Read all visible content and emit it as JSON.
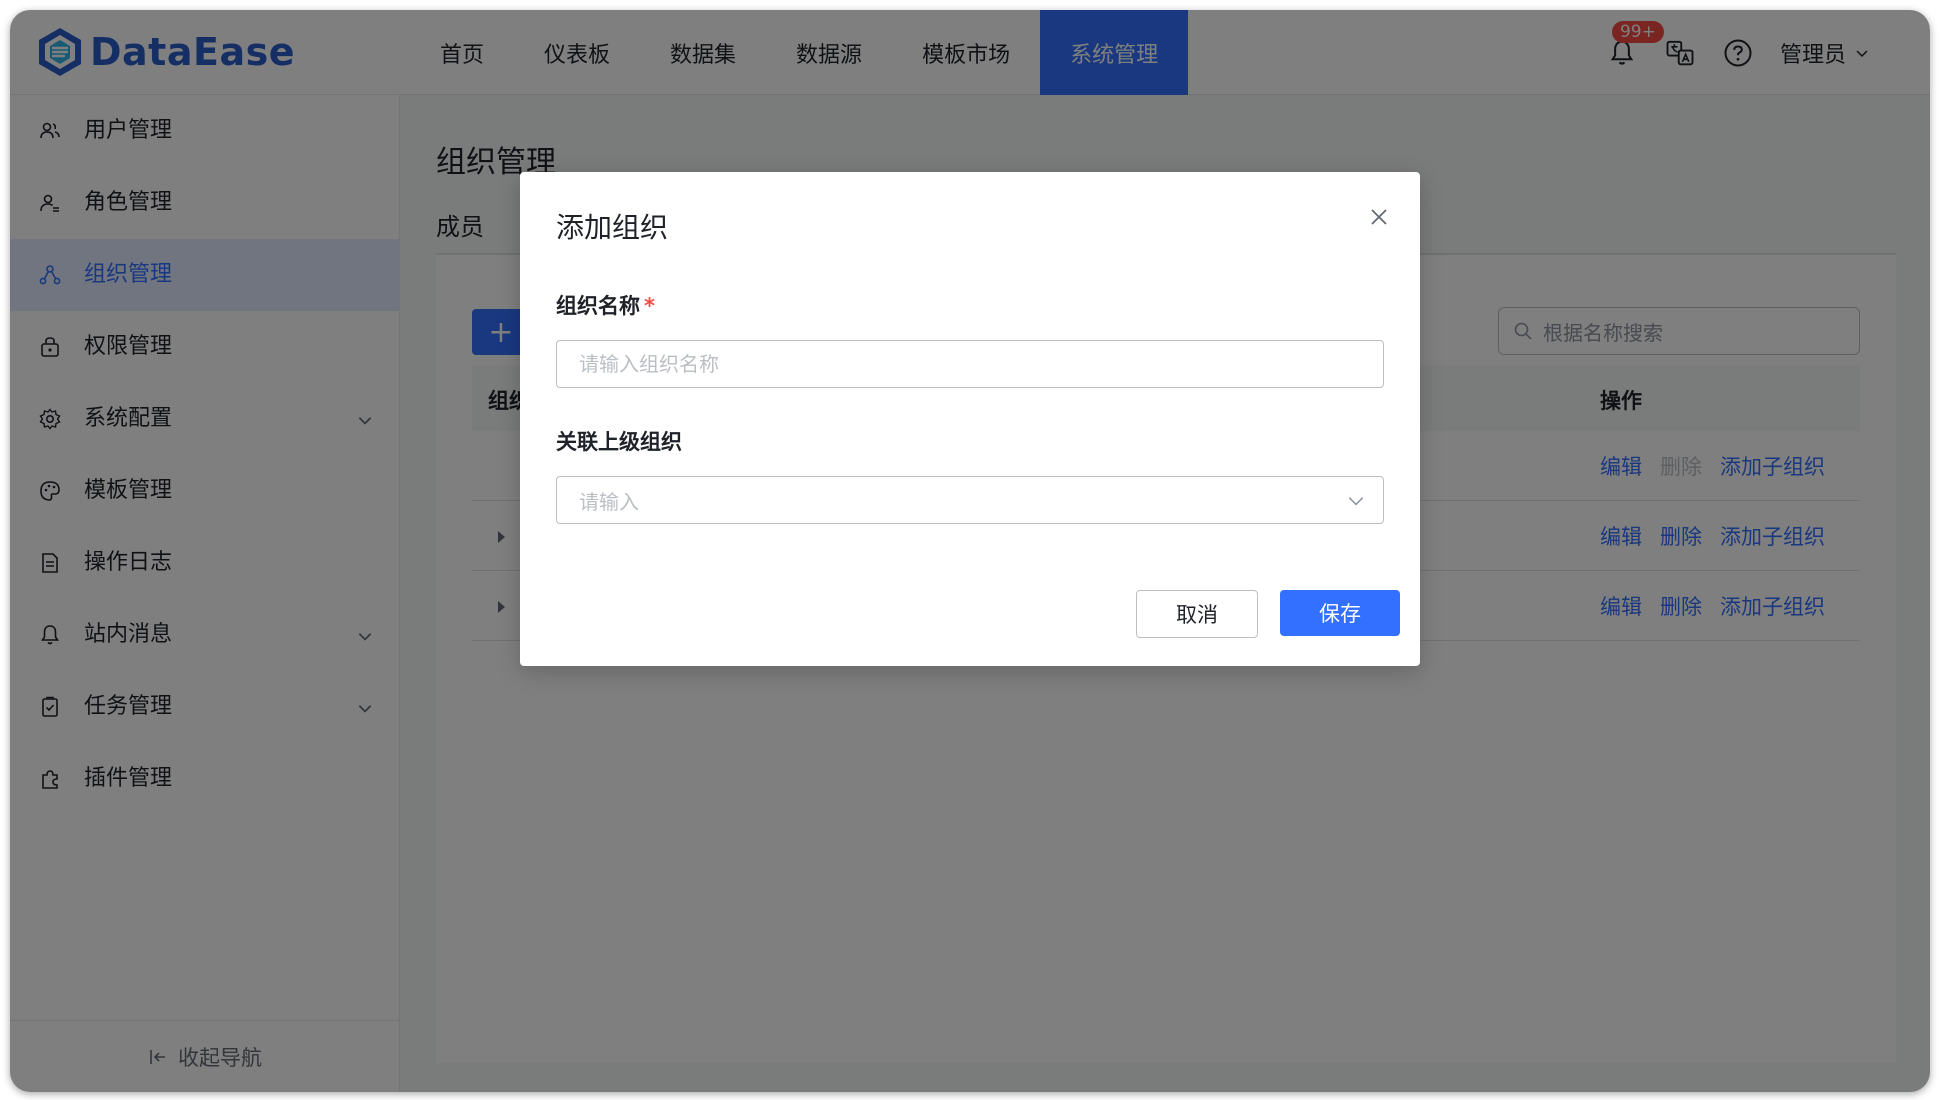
{
  "app": {
    "brand": "DataEase",
    "brand_color": "#2a5ecb",
    "accent": "#3370ff"
  },
  "topnav": {
    "items": [
      {
        "label": "首页"
      },
      {
        "label": "仪表板"
      },
      {
        "label": "数据集"
      },
      {
        "label": "数据源"
      },
      {
        "label": "模板市场"
      },
      {
        "label": "系统管理",
        "active": true
      }
    ]
  },
  "header": {
    "notification_badge": "99+",
    "user_name": "管理员"
  },
  "sidebar": {
    "items": [
      {
        "label": "用户管理",
        "icon": "users-icon"
      },
      {
        "label": "角色管理",
        "icon": "role-icon"
      },
      {
        "label": "组织管理",
        "icon": "org-icon",
        "active": true
      },
      {
        "label": "权限管理",
        "icon": "lock-icon"
      },
      {
        "label": "系统配置",
        "icon": "gear-icon",
        "expandable": true
      },
      {
        "label": "模板管理",
        "icon": "palette-icon"
      },
      {
        "label": "操作日志",
        "icon": "log-icon"
      },
      {
        "label": "站内消息",
        "icon": "bell-icon",
        "expandable": true
      },
      {
        "label": "任务管理",
        "icon": "task-icon",
        "expandable": true
      },
      {
        "label": "插件管理",
        "icon": "plugin-icon"
      }
    ],
    "collapse_label": "收起导航"
  },
  "main": {
    "page_title": "组织管理",
    "tab": "成员",
    "add_button": "+",
    "search_placeholder": "根据名称搜索",
    "table": {
      "col_name": "组织",
      "col_actions": "操作",
      "rows": [
        {
          "actions": [
            "编辑",
            "删除",
            "添加子组织"
          ],
          "delete_disabled": true
        },
        {
          "actions": [
            "编辑",
            "删除",
            "添加子组织"
          ]
        },
        {
          "actions": [
            "编辑",
            "删除",
            "添加子组织"
          ]
        }
      ]
    }
  },
  "dialog": {
    "title": "添加组织",
    "org_name_label": "组织名称",
    "required_mark": "*",
    "org_name_placeholder": "请输入组织名称",
    "parent_label": "关联上级组织",
    "parent_placeholder": "请输入",
    "cancel_label": "取消",
    "save_label": "保存"
  }
}
